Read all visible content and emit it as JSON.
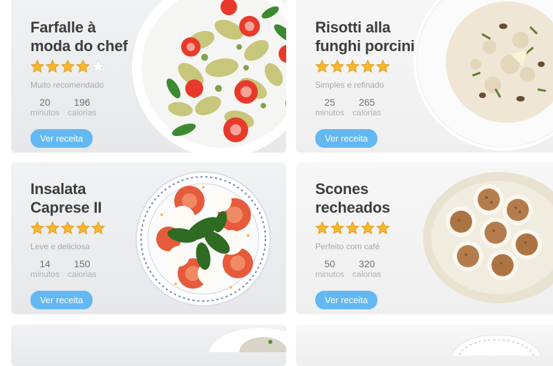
{
  "recipes": [
    {
      "title_line1": "Farfalle à",
      "title_line2": "moda do chef",
      "rating": 4,
      "rating_max": 5,
      "subtitle": "Muito recomendado",
      "time_value": "20",
      "time_label": "minutos",
      "cal_value": "196",
      "cal_label": "calorias",
      "button": "Ver receita"
    },
    {
      "title_line1": "Risotti alla",
      "title_line2": "funghi porcini",
      "rating": 5,
      "rating_max": 5,
      "subtitle": "Simples e refinado",
      "time_value": "25",
      "time_label": "minutos",
      "cal_value": "265",
      "cal_label": "calorias",
      "button": "Ver receita"
    },
    {
      "title_line1": "Insalata",
      "title_line2": "Caprese II",
      "rating": 5,
      "rating_max": 5,
      "subtitle": "Leve e deliciosa",
      "time_value": "14",
      "time_label": "minutos",
      "cal_value": "150",
      "cal_label": "calorias",
      "button": "Ver receita"
    },
    {
      "title_line1": "Scones",
      "title_line2": "recheados",
      "rating": 5,
      "rating_max": 5,
      "subtitle": "Perfeito com café",
      "time_value": "50",
      "time_label": "minutos",
      "cal_value": "320",
      "cal_label": "calorias",
      "button": "Ver receita"
    }
  ],
  "colors": {
    "star_filled": "#f7b731",
    "star_empty": "#e2e2e2",
    "button": "#64b8f2"
  }
}
